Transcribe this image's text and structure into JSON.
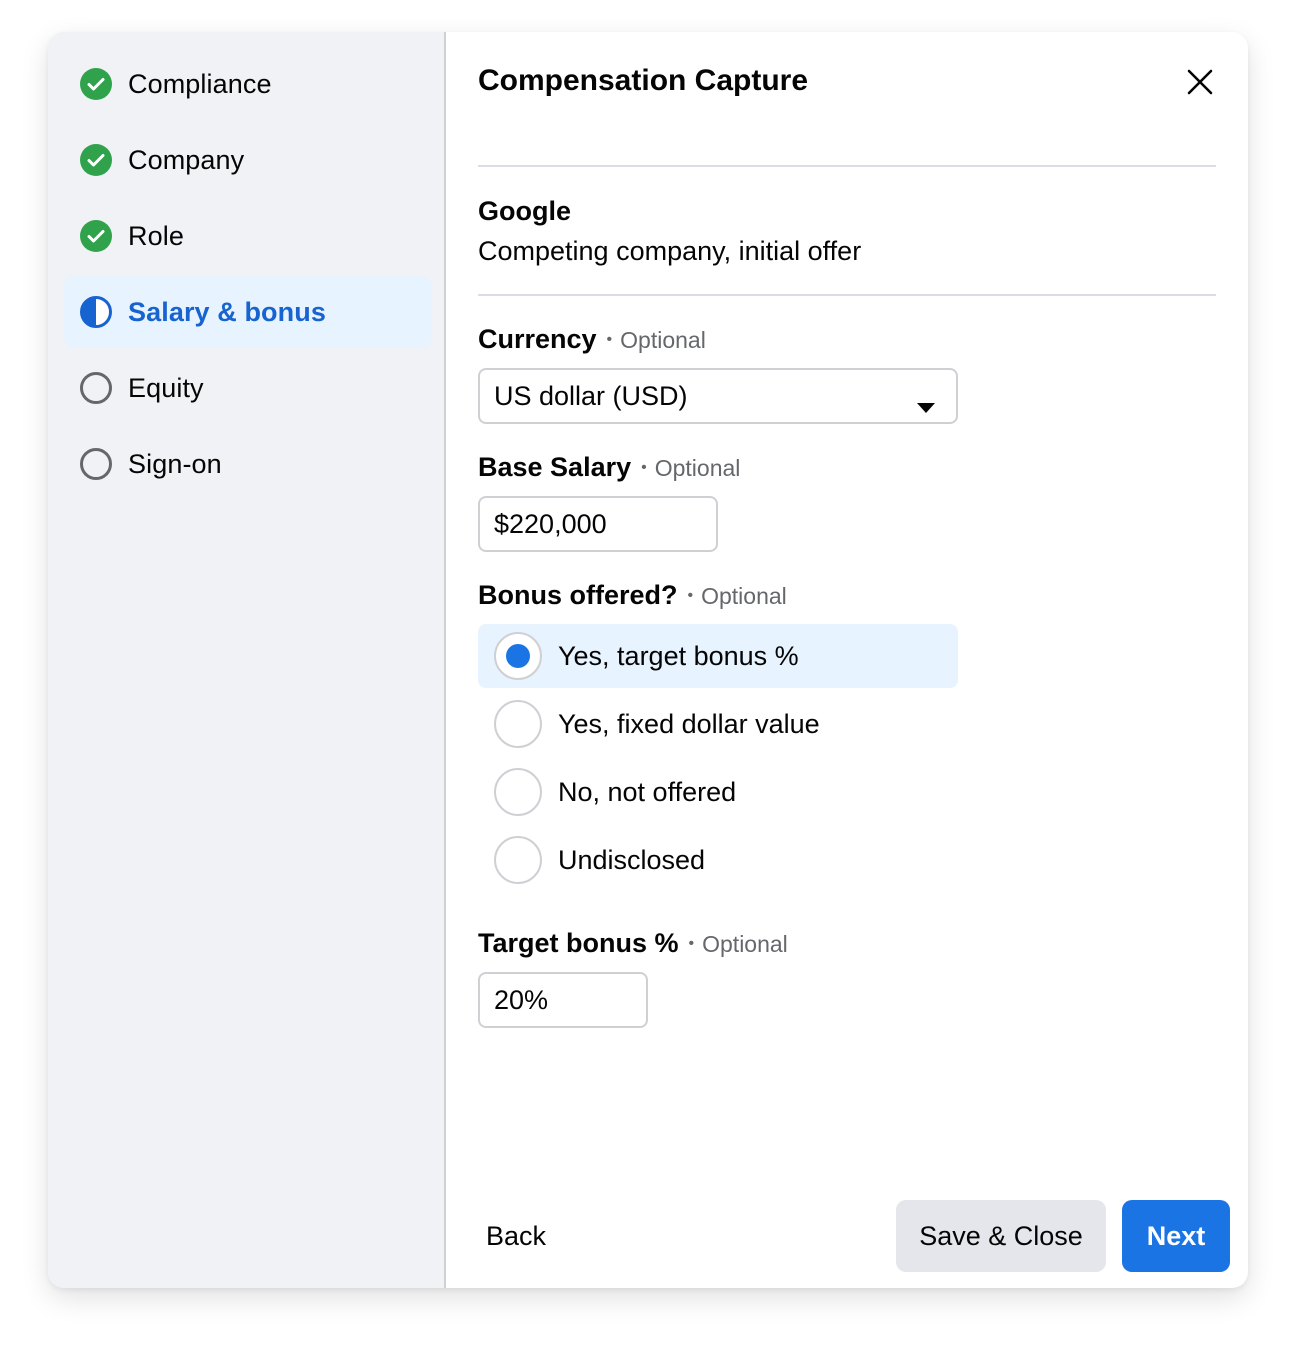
{
  "sidebar": {
    "steps": [
      {
        "label": "Compliance",
        "status": "complete",
        "icon": "check-circle-icon"
      },
      {
        "label": "Company",
        "status": "complete",
        "icon": "check-circle-icon"
      },
      {
        "label": "Role",
        "status": "complete",
        "icon": "check-circle-icon"
      },
      {
        "label": "Salary & bonus",
        "status": "in-progress",
        "icon": "half-circle-icon"
      },
      {
        "label": "Equity",
        "status": "not-started",
        "icon": "empty-circle-icon"
      },
      {
        "label": "Sign-on",
        "status": "not-started",
        "icon": "empty-circle-icon"
      }
    ]
  },
  "header": {
    "title": "Compensation Capture",
    "close_icon": "close-icon"
  },
  "company": {
    "name": "Google",
    "description": "Competing company, initial offer"
  },
  "form": {
    "optional_text": "Optional",
    "currency": {
      "label": "Currency",
      "value": "US dollar (USD)"
    },
    "base_salary": {
      "label": "Base Salary",
      "value": "$220,000"
    },
    "bonus": {
      "label": "Bonus offered?",
      "options": [
        {
          "label": "Yes, target bonus %",
          "selected": true
        },
        {
          "label": "Yes, fixed dollar value",
          "selected": false
        },
        {
          "label": "No, not offered",
          "selected": false
        },
        {
          "label": "Undisclosed",
          "selected": false
        }
      ]
    },
    "target_bonus": {
      "label": "Target bonus %",
      "value": "20%"
    }
  },
  "footer": {
    "back_label": "Back",
    "save_close_label": "Save & Close",
    "next_label": "Next"
  },
  "colors": {
    "accent": "#1b74e4",
    "active_text": "#1763cf",
    "complete": "#31a24c",
    "sidebar_bg": "#f0f2f5",
    "active_bg": "#e7f3ff"
  }
}
